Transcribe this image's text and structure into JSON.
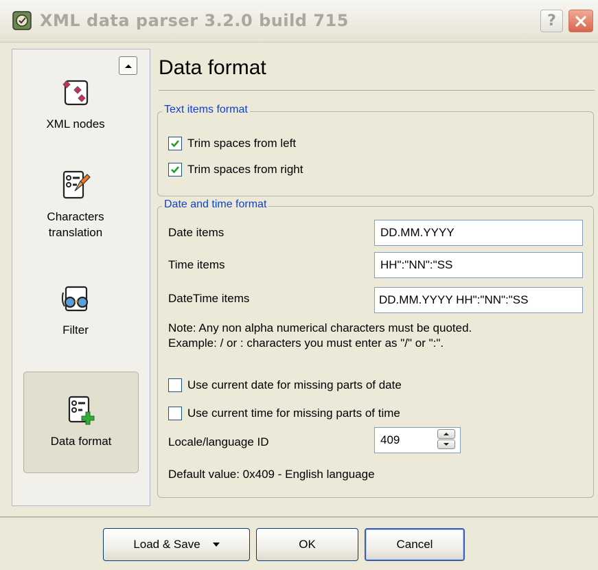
{
  "window": {
    "title": "XML data parser 3.2.0 build 715",
    "help_label": "?",
    "close_icon": "close-icon"
  },
  "sidebar": {
    "items": [
      {
        "label": "XML nodes",
        "icon": "xml-nodes-icon",
        "active": false
      },
      {
        "label": "Characters\ntranslation",
        "icon": "characters-translation-icon",
        "active": false
      },
      {
        "label": "Filter",
        "icon": "filter-icon",
        "active": false
      },
      {
        "label": "Data format",
        "icon": "data-format-icon",
        "active": true
      }
    ]
  },
  "main": {
    "title": "Data format",
    "text_group": {
      "legend": "Text items format",
      "trim_left": {
        "label": "Trim spaces from left",
        "checked": true
      },
      "trim_right": {
        "label": "Trim spaces from right",
        "checked": true
      }
    },
    "date_group": {
      "legend": "Date and time format",
      "date_label": "Date items",
      "date_value": "DD.MM.YYYY",
      "time_label": "Time items",
      "time_value": "HH\":\"NN\":\"SS",
      "datetime_label": "DateTime items",
      "datetime_value": "DD.MM.YYYY HH\":\"NN\":\"SS",
      "note_line1": "Note: Any non alpha numerical characters must be quoted.",
      "note_line2": "Example: / or : characters you must enter as \"/\" or \":\".",
      "use_current_date": {
        "label": "Use current date for missing parts of date",
        "checked": false
      },
      "use_current_time": {
        "label": "Use current time for missing parts of time",
        "checked": false
      },
      "locale_label": "Locale/language ID",
      "locale_value": "409",
      "default_value_note": "Default value: 0x409 - English language"
    }
  },
  "footer": {
    "load_save_label": "Load & Save",
    "ok_label": "OK",
    "cancel_label": "Cancel"
  },
  "colors": {
    "legend_blue": "#1040d0",
    "check_green": "#21a121",
    "window_bg": "#ece9d8"
  }
}
